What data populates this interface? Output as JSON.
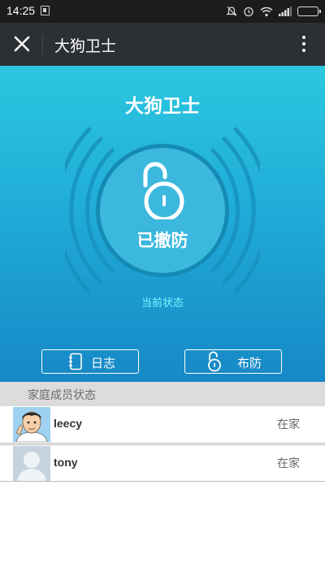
{
  "status_bar": {
    "time": "14:25",
    "icons": [
      "notification-muted-icon",
      "alarm-icon",
      "wifi-icon",
      "signal-icon",
      "battery-icon"
    ]
  },
  "nav": {
    "title": "大狗卫士",
    "close_icon": "close-icon",
    "more_icon": "more-vertical-icon"
  },
  "hero": {
    "title": "大狗卫士",
    "lock_state": "已撤防",
    "current_status_label": "当前状态",
    "log_button": {
      "label": "日志",
      "icon": "notebook-icon"
    },
    "arm_button": {
      "label": "布防",
      "icon": "unlock-icon"
    }
  },
  "family": {
    "header": "家庭成员状态",
    "members": [
      {
        "name": "leecy",
        "status": "在家",
        "avatar": "cartoon-avatar"
      },
      {
        "name": "tony",
        "status": "在家",
        "avatar": "default-avatar"
      }
    ]
  },
  "colors": {
    "hero_top": "#2cc7e0",
    "hero_bottom": "#1788c6",
    "accent_text": "#7cf6ff",
    "navbar": "#2c2f33",
    "statusbar": "#1c1c1c"
  }
}
